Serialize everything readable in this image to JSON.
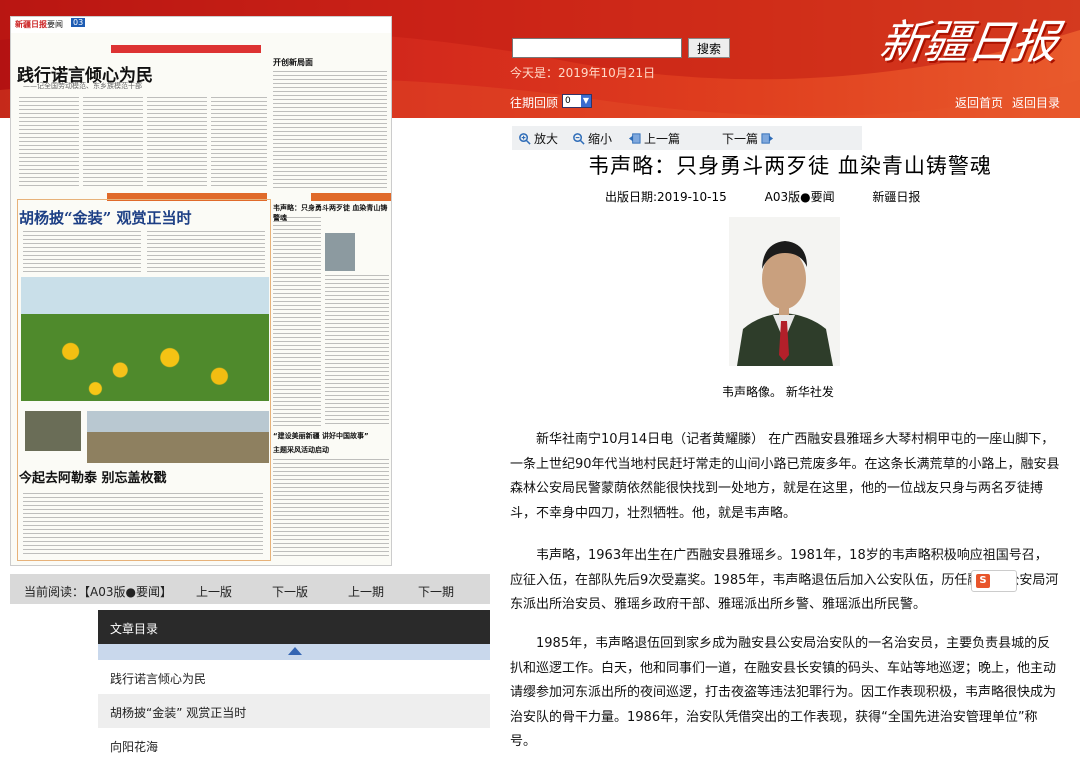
{
  "header": {
    "search_button": "搜索",
    "today": "今天是：2019年10月21日",
    "past_issue_label": "往期回顾",
    "past_issue_value": "0",
    "nav_home": "返回首页",
    "nav_index": "返回目录",
    "masthead": "新疆日报"
  },
  "newspaper": {
    "logo": "新疆日报",
    "section": "要闻",
    "page_num": "03",
    "headline_1": "践行诺言倾心为民",
    "headline_1_sub": "——记全国劳动模范、东乡族模范干部",
    "headline_2": "胡杨披“金装” 观赏正当时",
    "headline_3": "今起去阿勒泰 别忘盖枚戳",
    "side_1": "开创新局面",
    "side_2": "韦声略：只身勇斗两歹徒 血染青山铸警魂",
    "side_3": "“建设美丽新疆 讲好中国故事”",
    "side_4": "主题采风活动启动"
  },
  "page_nav": {
    "current_label": "当前阅读：【A03版●要闻】",
    "prev_page": "上一版",
    "next_page": "下一版",
    "prev_issue": "上一期",
    "next_issue": "下一期"
  },
  "toc": {
    "title": "文章目录",
    "items": [
      "践行诺言倾心为民",
      "胡杨披“金装” 观赏正当时",
      "向阳花海"
    ]
  },
  "toolbar": {
    "zoom_in": "放大",
    "zoom_out": "缩小",
    "prev_article": "上一篇",
    "next_article": "下一篇"
  },
  "article": {
    "title": "韦声略：只身勇斗两歹徒  血染青山铸警魂",
    "date": "出版日期:2019-10-15",
    "section": "A03版●要闻",
    "source": "新疆日报",
    "caption": "韦声略像。  新华社发",
    "paragraphs": [
      "新华社南宁10月14日电（记者黄耀滕）  在广西融安县雅瑶乡大琴村桐甲屯的一座山脚下，一条上世纪90年代当地村民赶圩常走的山间小路已荒废多年。在这条长满荒草的小路上，融安县森林公安局民警蒙荫依然能很快找到一处地方，就是在这里，他的一位战友只身与两名歹徒搏斗，不幸身中四刀，壮烈牺牲。他，就是韦声略。",
      "韦声略，1963年出生在广西融安县雅瑶乡。1981年，18岁的韦声略积极响应祖国号召，应征入伍，在部队先后9次受嘉奖。1985年，韦声略退伍后加入公安队伍，历任融安县公安局河东派出所治安员、雅瑶乡政府干部、雅瑶派出所乡警、雅瑶派出所民警。",
      "1985年，韦声略退伍回到家乡成为融安县公安局治安队的一名治安员，主要负责县城的反扒和巡逻工作。白天，他和同事们一道，在融安县长安镇的码头、车站等地巡逻；晚上，他主动请缨参加河东派出所的夜间巡逻，打击夜盗等违法犯罪行为。因工作表现积极，韦声略很快成为治安队的骨干力量。1986年，治安队凭借突出的工作表现，获得“全国先进治安管理单位”称号。"
    ]
  }
}
